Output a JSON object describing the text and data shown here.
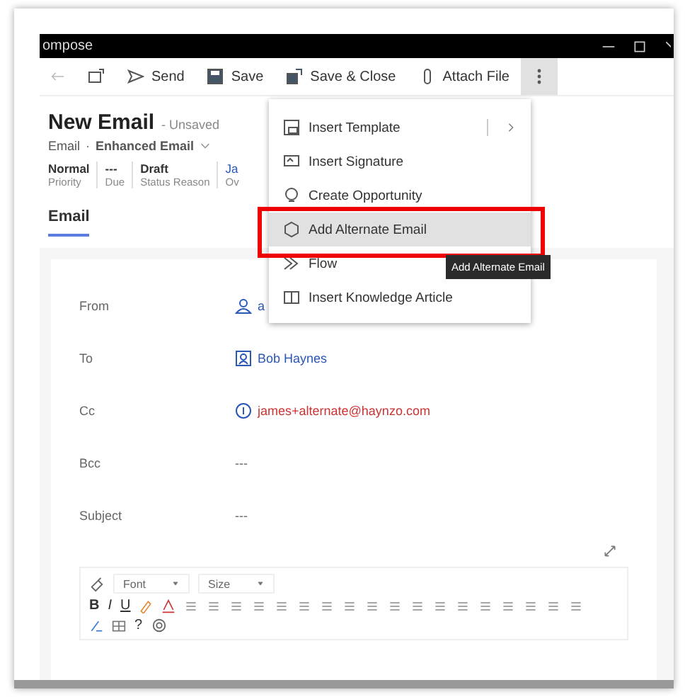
{
  "window": {
    "title": "ompose"
  },
  "toolbar": [
    {
      "label": "Send",
      "kind": "send"
    },
    {
      "label": "Save",
      "kind": "save"
    },
    {
      "label": "Save & Close",
      "kind": "saveclose"
    },
    {
      "label": "Attach File",
      "kind": "attach"
    }
  ],
  "more_button": {
    "pressed": true
  },
  "record": {
    "title": "New Email",
    "status": "- Unsaved",
    "type": "Email",
    "separator": "·",
    "form": "Enhanced Email"
  },
  "header_fields": [
    {
      "value": "Normal",
      "label": "Priority",
      "kind": "text"
    },
    {
      "value": "---",
      "label": "Due",
      "kind": "text"
    },
    {
      "value": "Draft",
      "label": "Status Reason",
      "kind": "text"
    },
    {
      "value": "Ja",
      "label": "Ov",
      "kind": "link"
    }
  ],
  "tabs": [
    {
      "label": "Email",
      "selected": true
    }
  ],
  "fields": [
    {
      "label": "From",
      "value": "a",
      "kind": "user"
    },
    {
      "label": "To",
      "value": "Bob Haynes",
      "kind": "contact"
    },
    {
      "label": "Cc",
      "value": "james+alternate@haynzo.com",
      "kind": "unresolved"
    },
    {
      "label": "Bcc",
      "value": "---",
      "kind": "empty"
    },
    {
      "label": "Subject",
      "value": "---",
      "kind": "empty"
    }
  ],
  "editor": {
    "font": "Font",
    "size": "Size",
    "format": [
      {
        "label": "B"
      },
      {
        "label": "I"
      },
      {
        "label": "U"
      }
    ],
    "help": "?"
  },
  "menu": {
    "items": [
      {
        "label": "Insert Template",
        "kind": "template",
        "submenu": true,
        "selected": false
      },
      {
        "label": "Insert Signature",
        "kind": "signature",
        "selected": false
      },
      {
        "label": "Create Opportunity",
        "kind": "opportunity",
        "selected": false
      },
      {
        "label": "Add Alternate Email",
        "kind": "alternate",
        "selected": true
      },
      {
        "label": "Flow",
        "kind": "flow",
        "selected": false
      },
      {
        "label": "Insert Knowledge Article",
        "kind": "article",
        "selected": false
      }
    ]
  },
  "tooltip": "Add Alternate Email"
}
